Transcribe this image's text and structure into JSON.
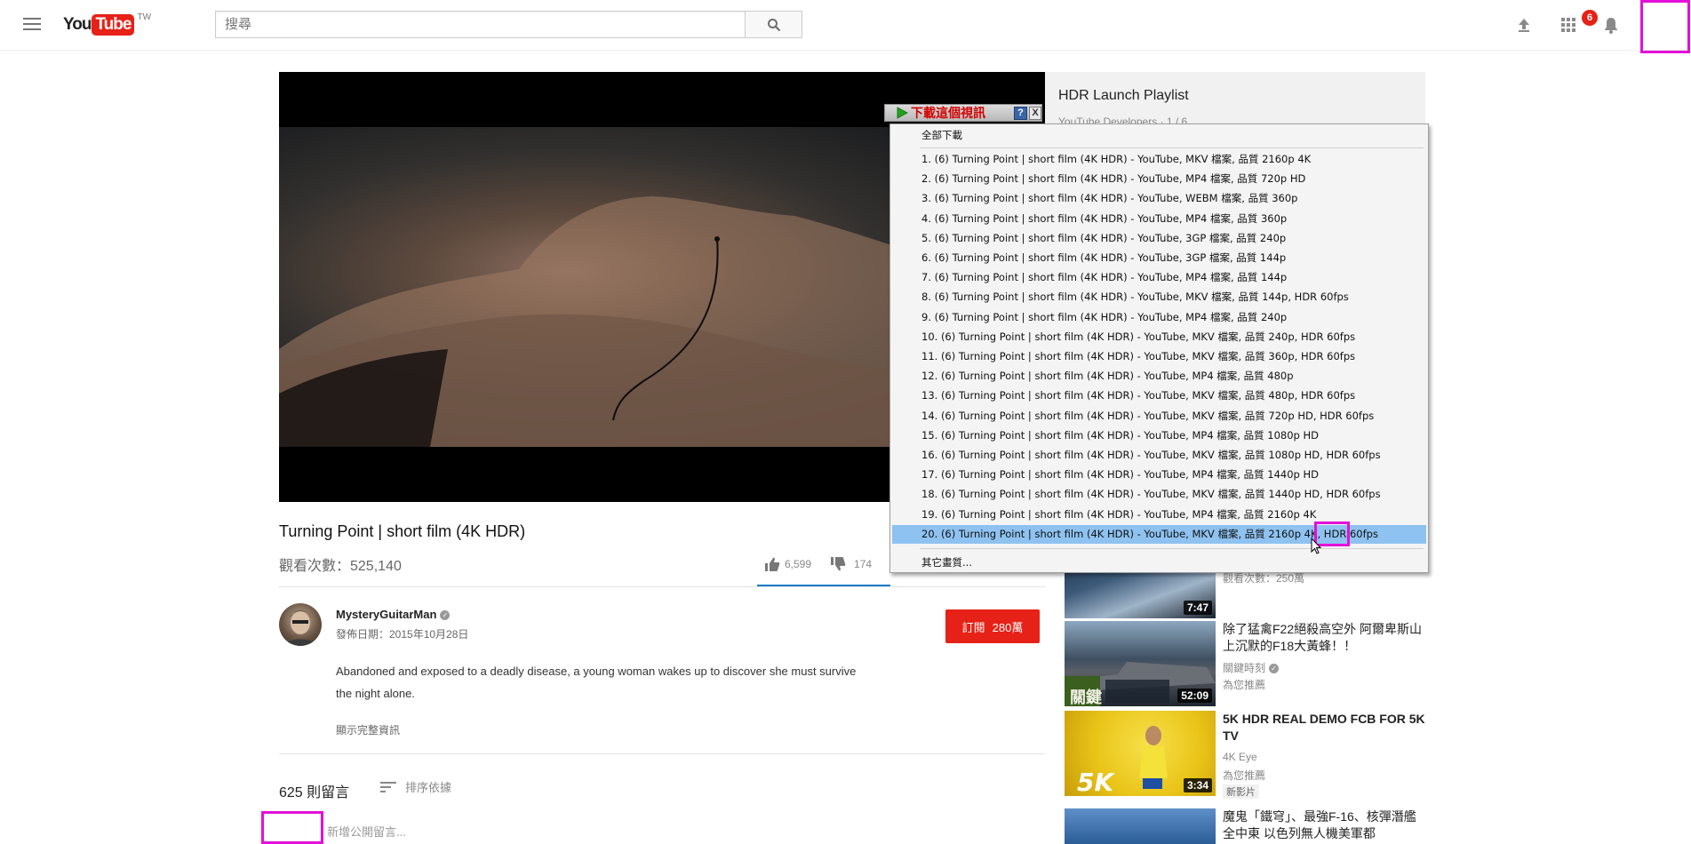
{
  "header": {
    "logo_you": "You",
    "logo_tube": "Tube",
    "logo_region": "TW",
    "search_placeholder": "搜尋",
    "notification_count": "6"
  },
  "video": {
    "title": "Turning Point | short film (4K HDR)",
    "views": "觀看次數：525,140",
    "likes": "6,599",
    "dislikes": "174",
    "channel": "MysteryGuitarMan",
    "published": "發佈日期：2015年10月28日",
    "subscribe_label": "訂閱",
    "subscriber_count": "280萬",
    "description": "Abandoned and exposed to a deadly disease, a young woman wakes up to discover she must survive the night alone.",
    "show_more": "顯示完整資訊"
  },
  "comments": {
    "count": "625 則留言",
    "sort_label": "排序依據",
    "input_placeholder": "新增公開留言..."
  },
  "sidebar": {
    "playlist_title": "HDR Launch Playlist",
    "playlist_subtitle": "YouTube Developers · 1 / 6",
    "recommendations": [
      {
        "title": "",
        "meta1": "觀看次數：250萬",
        "meta2": "",
        "badge": "",
        "duration": "7:47"
      },
      {
        "title": "除了猛禽F22絕殺高空外 阿爾卑斯山上沉默的F18大黃蜂！！",
        "meta1": "關鍵時刻",
        "meta2": "為您推薦",
        "badge": "",
        "duration": "52:09"
      },
      {
        "title": "5K HDR REAL DEMO FCB FOR 5K TV",
        "meta1": "4K Eye",
        "meta2": "為您推薦",
        "badge": "新影片",
        "duration": "3:34"
      },
      {
        "title": "魔鬼「鐵穹」、最強F-16、核彈潛艦全中東 以色列無人機美軍都",
        "meta1": "",
        "meta2": "",
        "badge": "",
        "duration": ""
      }
    ]
  },
  "download_popup": {
    "title": "下載這個視訊",
    "help": "?",
    "close": "X",
    "download_all": "全部下載",
    "items": [
      "1.  (6) Turning Point | short film (4K HDR) - YouTube,  MKV 檔案, 品質 2160p 4K",
      "2.  (6) Turning Point | short film (4K HDR) - YouTube,  MP4 檔案, 品質 720p HD",
      "3.  (6) Turning Point | short film (4K HDR) - YouTube,  WEBM 檔案, 品質 360p",
      "4.  (6) Turning Point | short film (4K HDR) - YouTube,  MP4 檔案, 品質 360p",
      "5.  (6) Turning Point | short film (4K HDR) - YouTube,  3GP 檔案, 品質 240p",
      "6.  (6) Turning Point | short film (4K HDR) - YouTube,  3GP 檔案, 品質 144p",
      "7.  (6) Turning Point | short film (4K HDR) - YouTube,  MP4 檔案, 品質 144p",
      "8.  (6) Turning Point | short film (4K HDR) - YouTube,  MKV 檔案, 品質 144p, HDR 60fps",
      "9.  (6) Turning Point | short film (4K HDR) - YouTube,  MP4 檔案, 品質 240p",
      "10.  (6) Turning Point | short film (4K HDR) - YouTube,  MKV 檔案, 品質 240p, HDR 60fps",
      "11.  (6) Turning Point | short film (4K HDR) - YouTube,  MKV 檔案, 品質 360p, HDR 60fps",
      "12.  (6) Turning Point | short film (4K HDR) - YouTube,  MP4 檔案, 品質 480p",
      "13.  (6) Turning Point | short film (4K HDR) - YouTube,  MKV 檔案, 品質 480p, HDR 60fps",
      "14.  (6) Turning Point | short film (4K HDR) - YouTube,  MKV 檔案, 品質 720p HD, HDR 60fps",
      "15.  (6) Turning Point | short film (4K HDR) - YouTube,  MP4 檔案, 品質 1080p HD",
      "16.  (6) Turning Point | short film (4K HDR) - YouTube,  MKV 檔案, 品質 1080p HD, HDR 60fps",
      "17.  (6) Turning Point | short film (4K HDR) - YouTube,  MP4 檔案, 品質 1440p HD",
      "18.  (6) Turning Point | short film (4K HDR) - YouTube,  MKV 檔案, 品質 1440p HD, HDR 60fps",
      "19.  (6) Turning Point | short film (4K HDR) - YouTube,  MP4 檔案, 品質 2160p 4K",
      "20.  (6) Turning Point | short film (4K HDR) - YouTube,  MKV 檔案, 品質 2160p 4K, HDR 60fps"
    ],
    "highlighted_index": 19,
    "other_quality": "其它畫質..."
  },
  "icons": {
    "menu": "hamburger-menu-icon",
    "search": "search-icon",
    "upload": "upload-icon",
    "apps": "apps-grid-icon",
    "notifications": "bell-icon",
    "like": "thumbs-up-icon",
    "dislike": "thumbs-down-icon",
    "sort": "sort-icon",
    "verified": "verified-check-icon"
  },
  "colors": {
    "brand_red": "#e62117",
    "highlight_blue": "#8ec2f0",
    "annotation_magenta": "#e40fd8",
    "like_bar": "#167ac6"
  }
}
